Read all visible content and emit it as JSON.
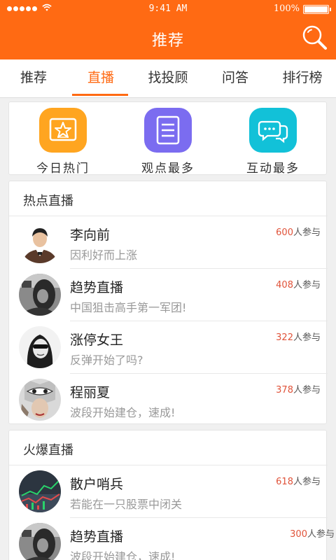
{
  "status": {
    "time": "9:41 AM",
    "battery": "100%"
  },
  "header": {
    "title": "推荐"
  },
  "tabs": [
    {
      "label": "推荐"
    },
    {
      "label": "直播"
    },
    {
      "label": "找投顾"
    },
    {
      "label": "问答"
    },
    {
      "label": "排行榜"
    }
  ],
  "active_tab": "直播",
  "quick": [
    {
      "label": "今日热门",
      "icon": "star-icon",
      "color": "#ffa520"
    },
    {
      "label": "观点最多",
      "icon": "list-icon",
      "color": "#7b6cf0"
    },
    {
      "label": "互动最多",
      "icon": "chat-bubbles-icon",
      "color": "#12c1d8"
    }
  ],
  "hot": {
    "title": "热点直播",
    "items": [
      {
        "name": "李向前",
        "desc": "因利好而上涨",
        "count": "600",
        "suffix": "人参与"
      },
      {
        "name": "趋势直播",
        "desc": "中国狙击高手第一军团!",
        "count": "408",
        "suffix": "人参与"
      },
      {
        "name": "涨停女王",
        "desc": "反弹开始了吗?",
        "count": "322",
        "suffix": "人参与"
      },
      {
        "name": "程丽夏",
        "desc": "波段开始建仓，速成!",
        "count": "378",
        "suffix": "人参与"
      }
    ]
  },
  "fire": {
    "title": "火爆直播",
    "items": [
      {
        "name": "散户哨兵",
        "desc": "若能在一只股票中闭关",
        "count": "618",
        "suffix": "人参与"
      },
      {
        "name": "趋势直播",
        "desc": "波段开始建仓，速成!",
        "count": "300",
        "suffix": "人参与"
      }
    ]
  },
  "colors": {
    "brand": "#ff6a13",
    "count": "#e0533a"
  }
}
